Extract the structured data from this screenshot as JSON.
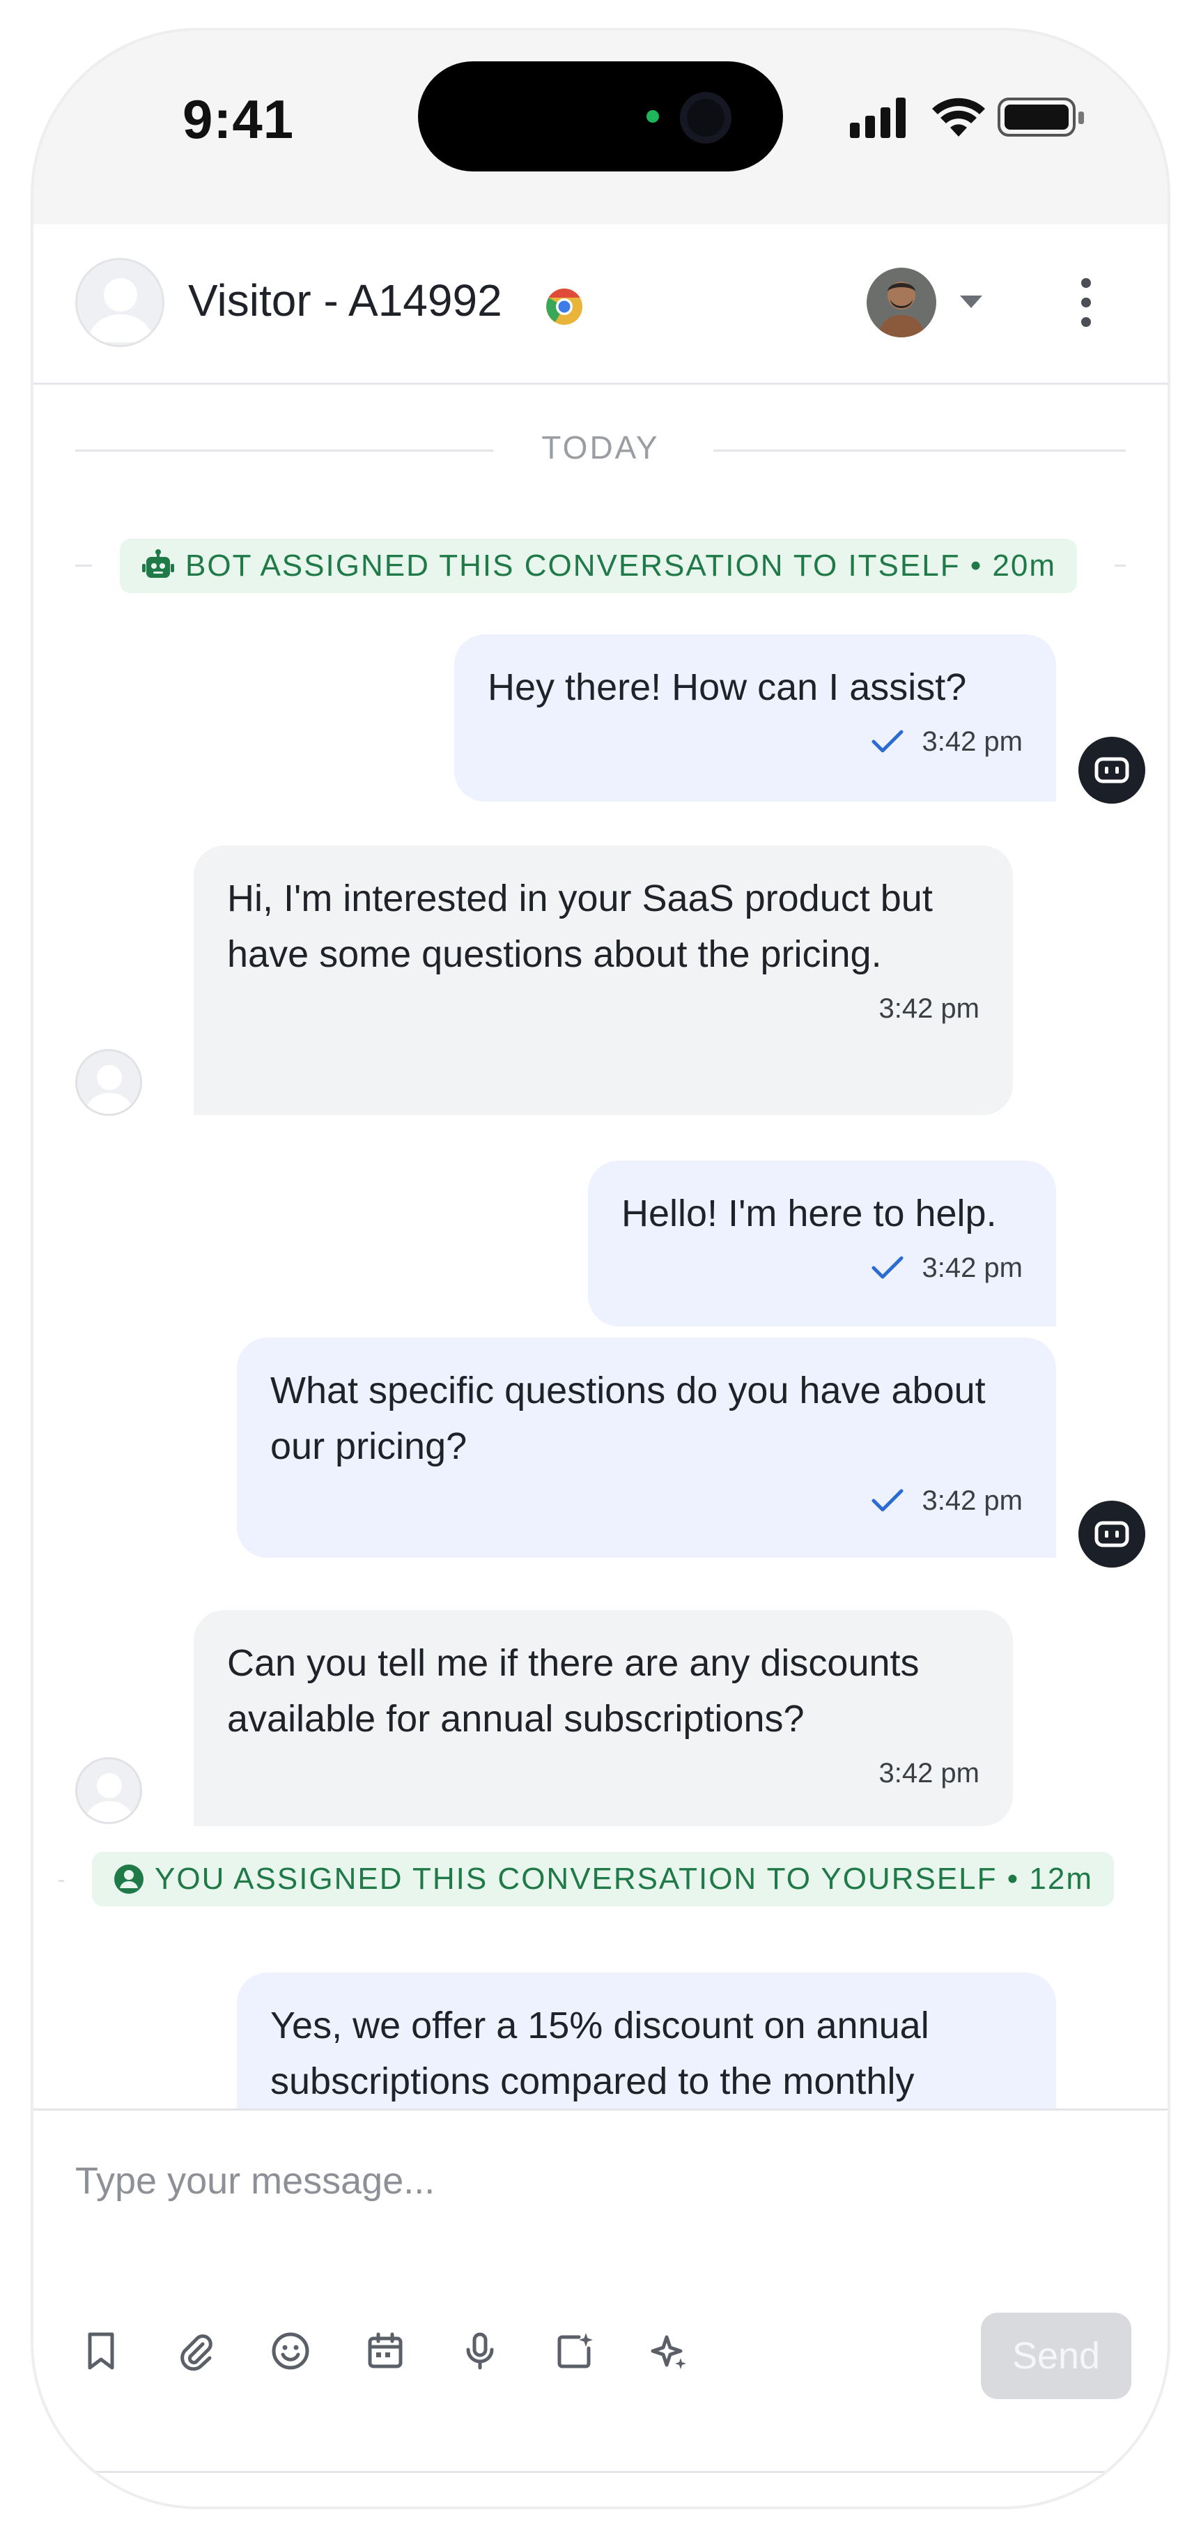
{
  "status_bar": {
    "time": "9:41"
  },
  "header": {
    "title": "Visitor - A14992",
    "browser_icon": "chrome-icon",
    "agent_avatar_icon": "agent-avatar",
    "menu_icon": "more-vertical-icon"
  },
  "chat": {
    "day_label": "TODAY",
    "system_events": [
      {
        "text": "BOT ASSIGNED THIS CONVERSATION TO ITSELF • 20m",
        "icon": "robot-icon"
      },
      {
        "text": "YOU ASSIGNED THIS CONVERSATION TO YOURSELF • 12m",
        "icon": "user-circle-icon"
      }
    ],
    "messages": [
      {
        "from": "agent",
        "text": "Hey there! How can I assist?",
        "time": "3:42 pm",
        "status": "sent"
      },
      {
        "from": "visitor",
        "text": "Hi, I'm interested in your SaaS product but have some questions about the pricing.",
        "time": "3:42 pm"
      },
      {
        "from": "agent",
        "text": "Hello! I'm here to help.",
        "time": "3:42 pm",
        "status": "sent"
      },
      {
        "from": "agent",
        "text": "What specific questions do you have about our pricing?",
        "time": "3:42 pm",
        "status": "sent"
      },
      {
        "from": "visitor",
        "text": "Can you tell me if there are any discounts available for annual subscriptions?",
        "time": "3:42 pm"
      },
      {
        "from": "agent",
        "text": "Yes, we offer a 15% discount on annual subscriptions compared to the monthly"
      }
    ]
  },
  "composer": {
    "placeholder": "Type your message...",
    "tools": [
      "bookmark-icon",
      "paperclip-icon",
      "emoji-icon",
      "calendar-icon",
      "microphone-icon",
      "add-media-icon",
      "ai-sparkle-icon"
    ],
    "send_label": "Send"
  },
  "colors": {
    "agent_bubble": "#eef2fe",
    "visitor_bubble": "#f2f3f5",
    "system_pill_bg": "#e8f6ee",
    "system_pill_text": "#1f7a48",
    "check": "#2b6cd4",
    "send_disabled": "#d8dadd"
  }
}
